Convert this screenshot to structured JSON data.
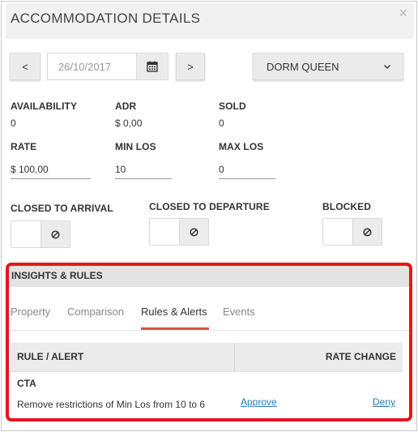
{
  "header": {
    "title": "ACCOMMODATION DETAILS",
    "close_glyph": "×"
  },
  "nav": {
    "prev_label": "<",
    "next_label": ">",
    "date_value": "26/10/2017"
  },
  "room_select": {
    "value": "DORM QUEEN"
  },
  "stats": {
    "availability": {
      "label": "AVAILABILITY",
      "value": "0"
    },
    "adr": {
      "label": "ADR",
      "value": "$ 0,00"
    },
    "sold": {
      "label": "SOLD",
      "value": "0"
    }
  },
  "editable": {
    "rate": {
      "label": "RATE",
      "value": "$ 100,00"
    },
    "min_los": {
      "label": "MIN LOS",
      "value": "10"
    },
    "max_los": {
      "label": "MAX LOS",
      "value": "0"
    }
  },
  "restrictions": {
    "closed_arrival": {
      "label": "CLOSED TO ARRIVAL",
      "icon": "ban-icon"
    },
    "closed_departure": {
      "label": "CLOSED TO DEPARTURE",
      "icon": "ban-icon"
    },
    "blocked": {
      "label": "BLOCKED",
      "icon": "ban-icon"
    }
  },
  "insights": {
    "title": "INSIGHTS & RULES",
    "tabs": [
      {
        "label": "Property"
      },
      {
        "label": "Comparison"
      },
      {
        "label": "Rules & Alerts",
        "active": true
      },
      {
        "label": "Events"
      }
    ],
    "table": {
      "columns": [
        "RULE / ALERT",
        "RATE CHANGE"
      ],
      "rows": [
        {
          "type": "CTA",
          "description": "Remove restrictions of Min Los from 10 to 6",
          "approve_label": "Approve",
          "deny_label": "Deny"
        }
      ]
    }
  },
  "colors": {
    "highlight_border": "#e8151b",
    "active_tab_underline": "#d9534f",
    "link": "#2a7ab5"
  }
}
